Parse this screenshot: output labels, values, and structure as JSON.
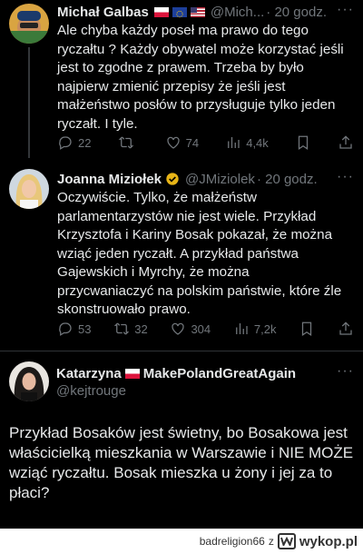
{
  "tweets": [
    {
      "name": "Michał Galbas",
      "handle": "@Mich...",
      "time": "· 20 godz.",
      "text": "Ale chyba każdy poseł ma prawo do tego\nryczałtu ? Każdy obywatel może korzystać jeśli\njest to zgodne z prawem. Trzeba by było\nnajpierw zmienić przepisy że jeśli jest\nmałżeństwo posłów to przysługuje tylko  jeden\nryczałt. I tyle.",
      "replies": "22",
      "reposts": "",
      "likes": "74",
      "views": "4,4k"
    },
    {
      "name": "Joanna Miziołek",
      "handle": "@JMiziolek",
      "time": "· 20 godz.",
      "text": "Oczywiście. Tylko, że małżeństw\nparlamentarzystów nie jest wiele. Przykład\nKrzysztofa i Kariny Bosak pokazał, że można\nwziąć jeden ryczałt. A przykład państwa\nGajewskich i Myrchy, że można\nprzycwaniaczyć na polskim państwie, które źle\nskonstruowało prawo.",
      "replies": "53",
      "reposts": "32",
      "likes": "304",
      "views": "7,2k"
    }
  ],
  "main_tweet": {
    "name": "Katarzyna",
    "name_suffix": "MakePolandGreatAgain",
    "handle": "@kejtrouge",
    "text": "Przykład Bosaków jest świetny, bo Bosakowa jest właścicielką mieszkania w Warszawie i NIE MOŻE wziąć ryczałtu. Bosak mieszka u żony i jej za to płaci?"
  },
  "footer": {
    "user": "badreligion66",
    "connector": "z",
    "brand": "wykop.pl"
  },
  "icons": [
    "reply-icon",
    "repost-icon",
    "like-icon",
    "views-icon",
    "bookmark-icon",
    "share-icon",
    "more-icon"
  ]
}
